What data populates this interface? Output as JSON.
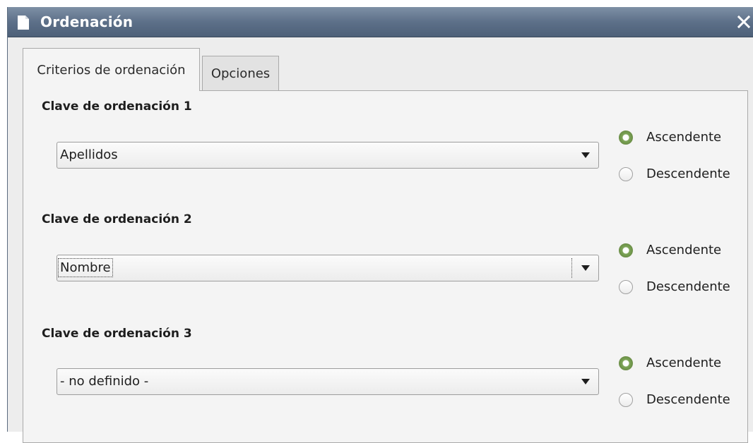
{
  "window": {
    "title": "Ordenación"
  },
  "tabs": [
    {
      "label": "Criterios de ordenación",
      "active": true
    },
    {
      "label": "Opciones",
      "active": false
    }
  ],
  "sort_keys": [
    {
      "label": "Clave de ordenación 1",
      "selected": "Apellidos",
      "ascending_label": "Ascendente",
      "descending_label": "Descendente",
      "order": "ascending"
    },
    {
      "label": "Clave de ordenación 2",
      "selected": "Nombre",
      "ascending_label": "Ascendente",
      "descending_label": "Descendente",
      "order": "ascending"
    },
    {
      "label": "Clave de ordenación 3",
      "selected": "- no definido -",
      "ascending_label": "Ascendente",
      "descending_label": "Descendente",
      "order": "ascending"
    }
  ],
  "colors": {
    "titlebar": "#5d7089",
    "radio_checked": "#7ea559"
  },
  "icons": {
    "title": "document-icon",
    "close": "close-icon",
    "dropdown": "chevron-down-icon"
  }
}
